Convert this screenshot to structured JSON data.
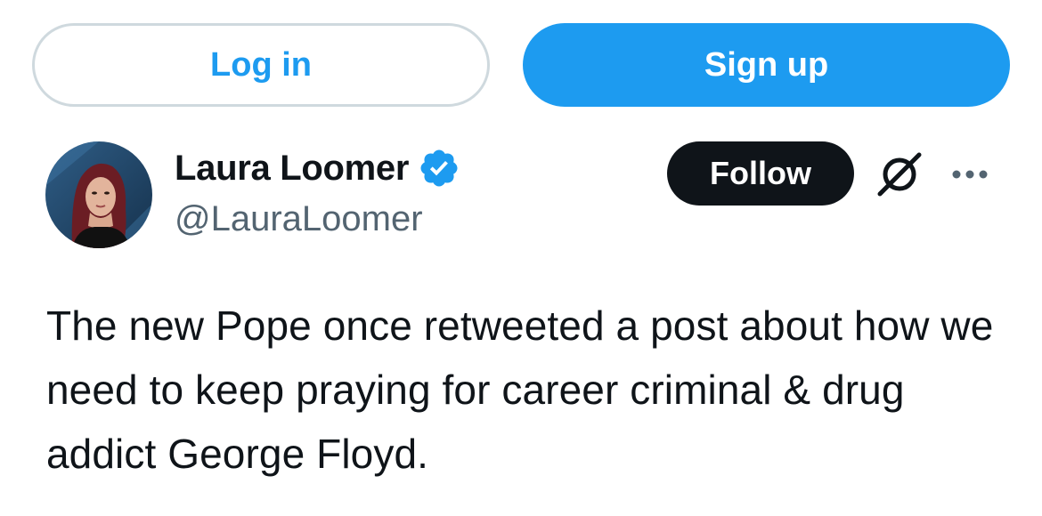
{
  "auth": {
    "login_label": "Log in",
    "signup_label": "Sign up"
  },
  "author": {
    "display_name": "Laura Loomer",
    "handle": "@LauraLoomer",
    "verified": true,
    "avatar_icon": "profile-photo"
  },
  "actions": {
    "follow_label": "Follow",
    "grok_icon": "grok-icon",
    "more_icon": "more-options-icon"
  },
  "tweet": {
    "text": "The new Pope once retweeted a post about how we need to keep praying for career criminal & drug addict George Floyd."
  },
  "colors": {
    "brand_blue": "#1d9bf0",
    "text_primary": "#0f1419",
    "text_secondary": "#536471",
    "border": "#cfd9de"
  }
}
